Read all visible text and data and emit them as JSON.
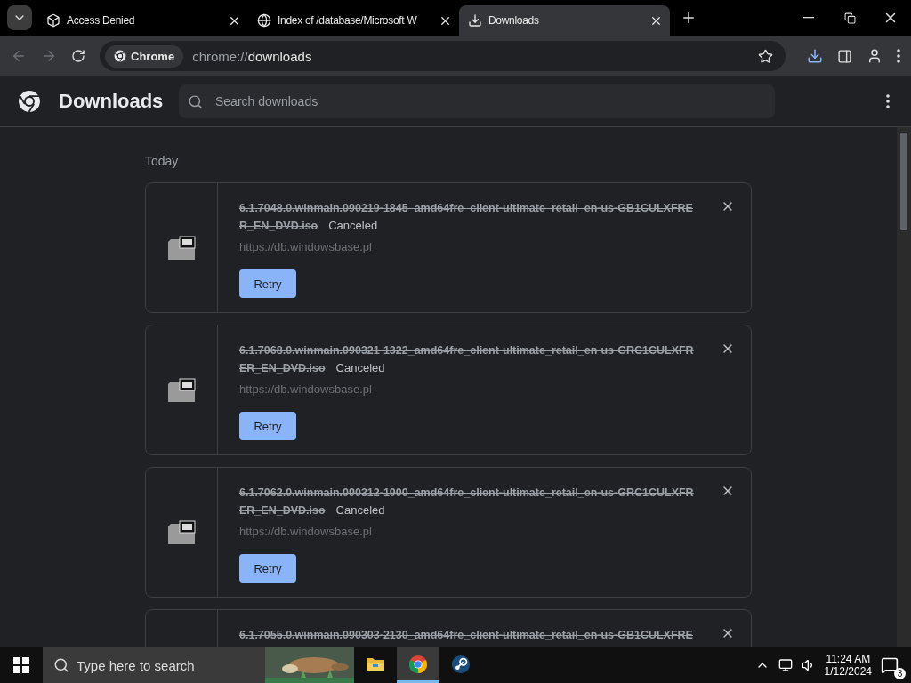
{
  "tabs": [
    {
      "title": "Access Denied",
      "selected": false
    },
    {
      "title": "Index of /database/Microsoft W",
      "selected": false
    },
    {
      "title": "Downloads",
      "selected": true
    }
  ],
  "toolbar": {
    "chip": "Chrome",
    "url_scheme": "chrome://",
    "url_path": "downloads"
  },
  "page": {
    "title": "Downloads",
    "search": {
      "placeholder": "Search downloads"
    },
    "section": "Today",
    "downloads": [
      {
        "file": "6.1.7048.0.winmain.090219-1845_amd64fre_client-ultimate_retail_en-us-GB1CULXFRER_EN_DVD.iso",
        "status": "Canceled",
        "source": "https://db.windowsbase.pl",
        "action": "Retry"
      },
      {
        "file": "6.1.7068.0.winmain.090321-1322_amd64fre_client-ultimate_retail_en-us-GRC1CULXFRER_EN_DVD.iso",
        "status": "Canceled",
        "source": "https://db.windowsbase.pl",
        "action": "Retry"
      },
      {
        "file": "6.1.7062.0.winmain.090312-1900_amd64fre_client-ultimate_retail_en-us-GRC1CULXFRER_EN_DVD.iso",
        "status": "Canceled",
        "source": "https://db.windowsbase.pl",
        "action": "Retry"
      },
      {
        "file": "6.1.7055.0.winmain.090303-2130_amd64fre_client-ultimate_retail_en-us-GB1CULXFRE"
      }
    ]
  },
  "taskbar": {
    "search": {
      "placeholder": "Type here to search"
    },
    "apps": [
      {
        "active": false
      },
      {
        "active": true
      },
      {
        "active": false
      }
    ],
    "time": "11:24 AM",
    "date": "1/12/2024",
    "notifications": "3"
  }
}
